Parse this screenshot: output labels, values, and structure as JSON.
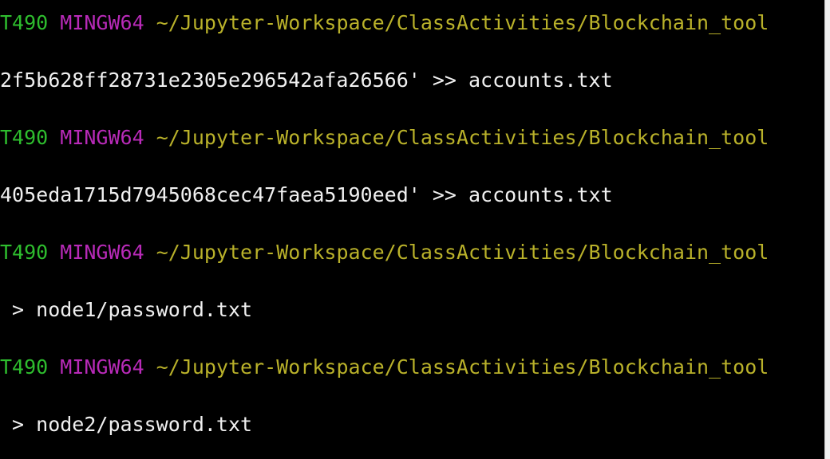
{
  "terminal": {
    "lines": [
      {
        "type": "prompt",
        "host": "T490",
        "shell": "MINGW64",
        "path": "~/Jupyter-Workspace/ClassActivities/Blockchain_tool"
      },
      {
        "type": "output",
        "text": "2f5b628ff28731e2305e296542afa26566' >> accounts.txt"
      },
      {
        "type": "prompt",
        "host": "T490",
        "shell": "MINGW64",
        "path": "~/Jupyter-Workspace/ClassActivities/Blockchain_tool"
      },
      {
        "type": "output",
        "text": "405eda1715d7945068cec47faea5190eed' >> accounts.txt"
      },
      {
        "type": "prompt",
        "host": "T490",
        "shell": "MINGW64",
        "path": "~/Jupyter-Workspace/ClassActivities/Blockchain_tool"
      },
      {
        "type": "output",
        "text": " > node1/password.txt"
      },
      {
        "type": "prompt",
        "host": "T490",
        "shell": "MINGW64",
        "path": "~/Jupyter-Workspace/ClassActivities/Blockchain_tool"
      },
      {
        "type": "output",
        "text": " > node2/password.txt"
      }
    ]
  },
  "colors": {
    "background": "#000000",
    "host": "#2ebd2e",
    "shell": "#b82ab8",
    "path": "#b9b12a",
    "text": "#f0f0f0"
  }
}
